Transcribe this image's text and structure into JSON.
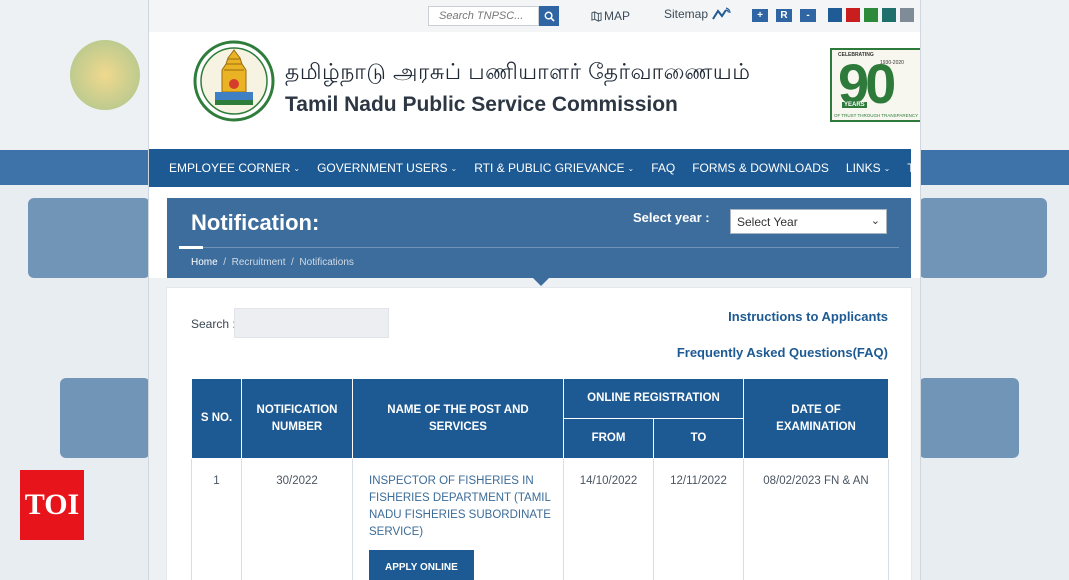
{
  "topbar": {
    "search_placeholder": "Search TNPSC...",
    "map_label": "MAP",
    "sitemap_label": "Sitemap",
    "font_buttons": [
      "+",
      "R",
      "-"
    ],
    "theme_swatches": [
      "#1f5b94",
      "#c81e1e",
      "#2d8a3a",
      "#1f6f6a",
      "#7f8b96"
    ]
  },
  "header": {
    "title_tamil": "தமிழ்நாடு அரசுப் பணியாளர் தேர்வாணையம்",
    "title_english": "Tamil Nadu Public Service Commission",
    "badge_number": "90",
    "badge_top": "CELEBRATING",
    "badge_years_range": "1930-2020",
    "badge_years": "YEARS",
    "badge_tagline": "OF TRUST THROUGH TRANSPARENCY"
  },
  "nav": {
    "items": [
      {
        "label": "EMPLOYEE CORNER",
        "dropdown": true
      },
      {
        "label": "GOVERNMENT USERS",
        "dropdown": true
      },
      {
        "label": "RTI & PUBLIC GRIEVANCE",
        "dropdown": true
      },
      {
        "label": "FAQ",
        "dropdown": false
      },
      {
        "label": "FORMS & DOWNLOADS",
        "dropdown": false
      },
      {
        "label": "LINKS",
        "dropdown": true
      },
      {
        "label": "TENDERS",
        "dropdown": false
      }
    ]
  },
  "banner": {
    "title": "Notification:",
    "select_year_label": "Select year :",
    "select_year_value": "Select Year",
    "breadcrumb": [
      "Home",
      "Recruitment",
      "Notifications"
    ]
  },
  "content": {
    "search_label": "Search :",
    "link_instructions": "Instructions to Applicants",
    "link_faq": "Frequently Asked Questions(FAQ)"
  },
  "table": {
    "headers": {
      "sno": "S NO.",
      "notification_number": "NOTIFICATION NUMBER",
      "post_name": "NAME OF THE POST AND SERVICES",
      "online_registration": "ONLINE REGISTRATION",
      "from": "FROM",
      "to": "TO",
      "exam_date": "DATE OF EXAMINATION"
    },
    "rows": [
      {
        "sno": "1",
        "notification_number": "30/2022",
        "post_name": "INSPECTOR OF FISHERIES IN FISHERIES DEPARTMENT (TAMIL NADU FISHERIES SUBORDINATE SERVICE)",
        "from": "14/10/2022",
        "to": "12/11/2022",
        "exam_date": "08/02/2023 FN & AN",
        "apply_label": "APPLY ONLINE"
      }
    ]
  },
  "watermark": {
    "logo_text": "TOI"
  }
}
